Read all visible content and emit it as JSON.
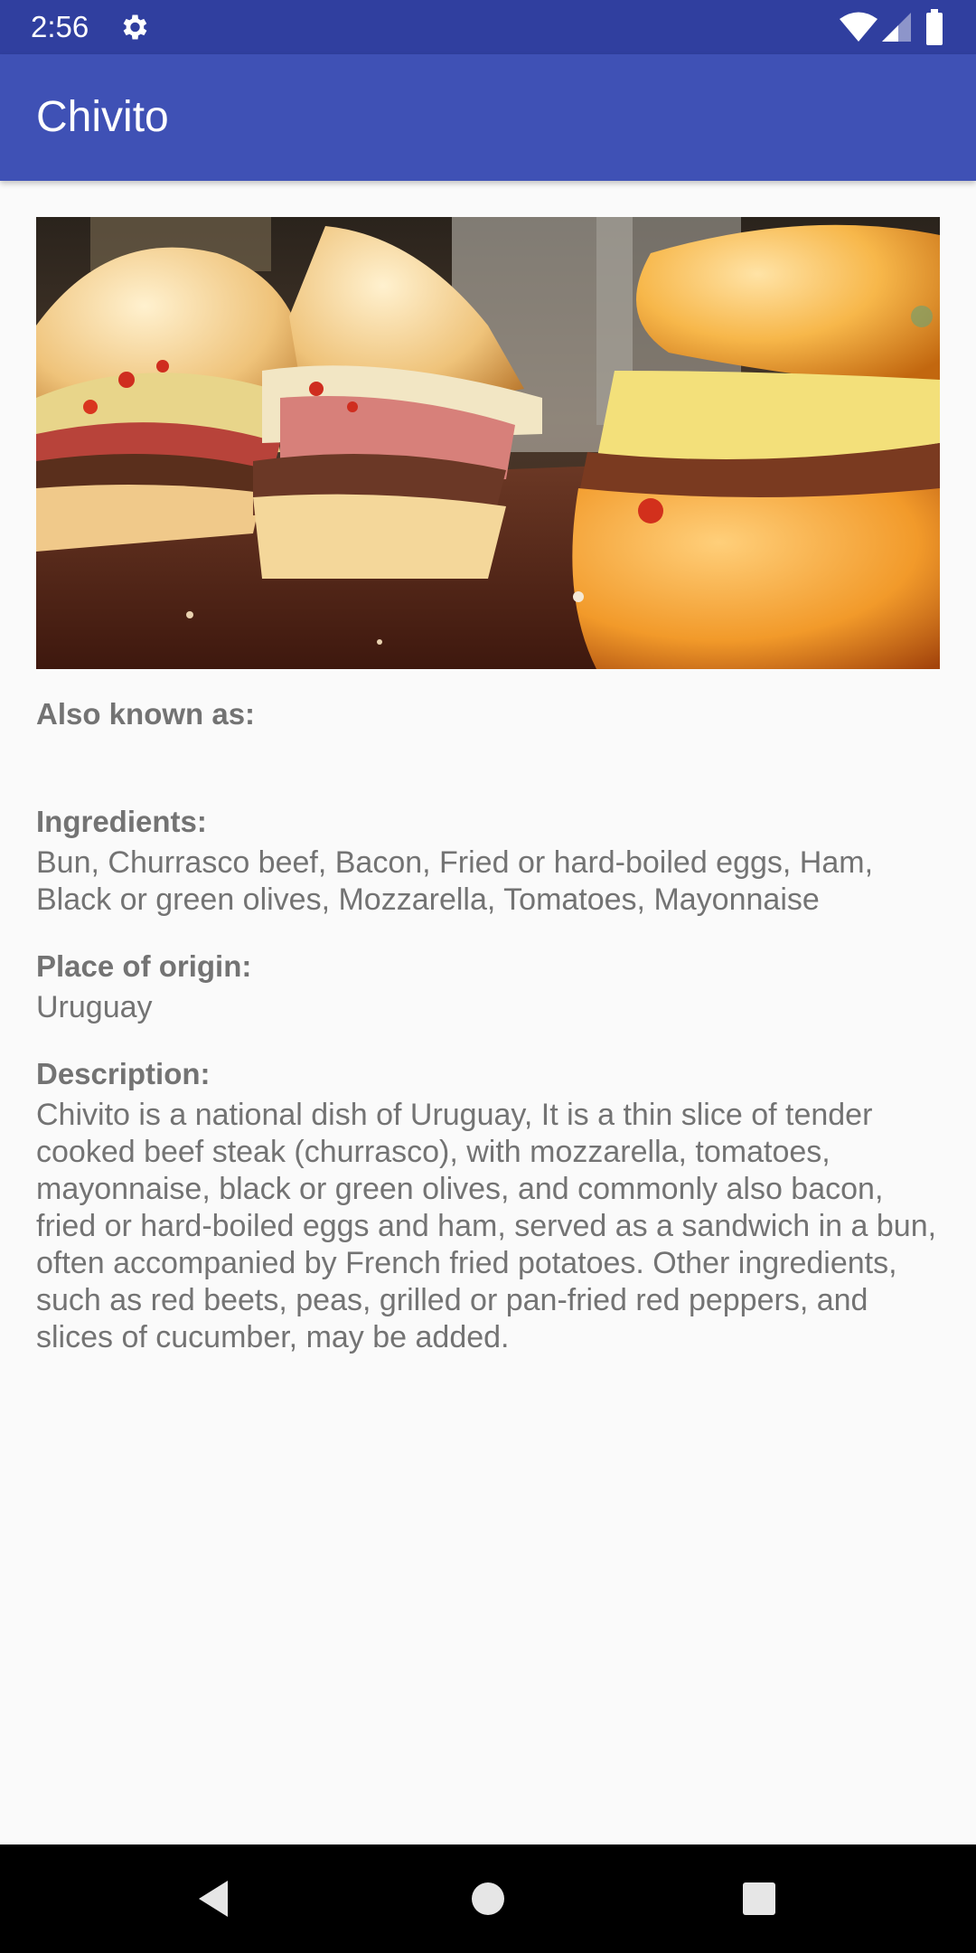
{
  "status_bar": {
    "time": "2:56",
    "icons": [
      "gear-icon",
      "wifi-icon",
      "signal-icon",
      "battery-icon"
    ],
    "color": "#303f9f"
  },
  "app_bar": {
    "title": "Chivito",
    "color": "#3f51b5"
  },
  "dish": {
    "image_subject": "sandwich photo",
    "also_known_as": {
      "label": "Also known as:",
      "value": ""
    },
    "ingredients": {
      "label": "Ingredients:",
      "value": "Bun, Churrasco beef, Bacon, Fried or hard-boiled eggs, Ham, Black or green olives, Mozzarella, Tomatoes, Mayonnaise"
    },
    "place_of_origin": {
      "label": "Place of origin:",
      "value": "Uruguay"
    },
    "description": {
      "label": "Description:",
      "value": "Chivito is a national dish of Uruguay, It is a thin slice of tender cooked beef steak (churrasco), with mozzarella, tomatoes, mayonnaise, black or green olives, and commonly also bacon, fried or hard-boiled eggs and ham, served as a sandwich in a bun, often accompanied by French fried potatoes. Other ingredients, such as red beets, peas, grilled or pan-fried red peppers, and slices of cucumber, may be added."
    }
  },
  "nav_bar": {
    "buttons": [
      "back-icon",
      "home-icon",
      "recents-icon"
    ]
  }
}
